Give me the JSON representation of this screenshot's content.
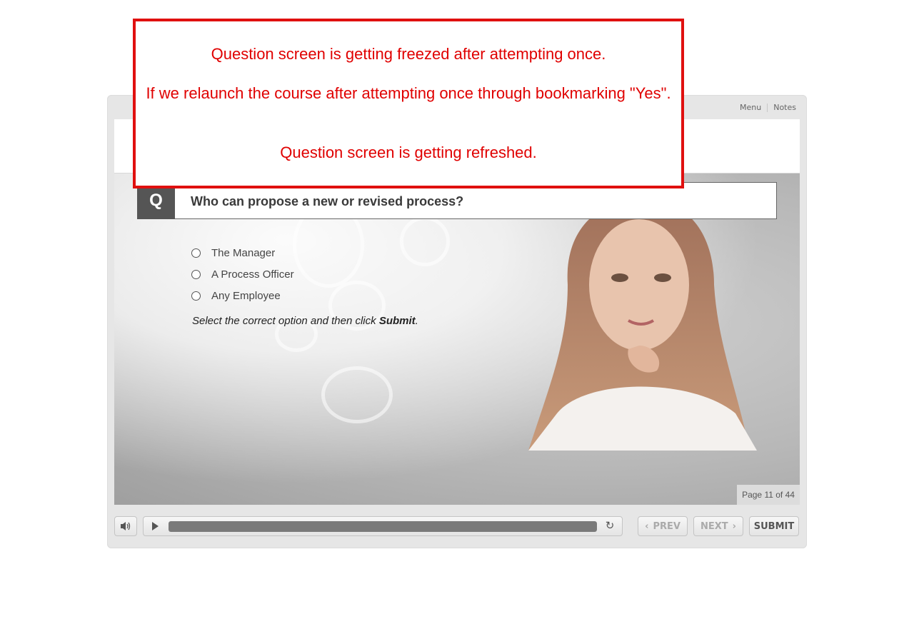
{
  "annotation": {
    "line1": "Question screen is getting freezed after attempting once.",
    "line2": "If we relaunch the course after attempting once through bookmarking \"Yes\".",
    "line3": "Question screen is getting refreshed."
  },
  "topbar": {
    "menu": "Menu",
    "notes": "Notes"
  },
  "question": {
    "badge": "Q",
    "text": "Who can propose a new or revised process?",
    "options": [
      "The Manager",
      "A Process Officer",
      "Any Employee"
    ],
    "instruction_prefix": "Select the correct option and then click ",
    "instruction_bold": "Submit",
    "instruction_suffix": "."
  },
  "page_indicator": "Page 11 of 44",
  "controls": {
    "progress": 1.0,
    "prev": "PREV",
    "next": "NEXT",
    "submit": "SUBMIT",
    "volume_icon": "speaker-icon",
    "play_icon": "play-icon",
    "replay_icon": "replay-icon"
  },
  "colors": {
    "annotation": "#e00000",
    "badge": "#555555",
    "shell": "#e6e6e6"
  }
}
